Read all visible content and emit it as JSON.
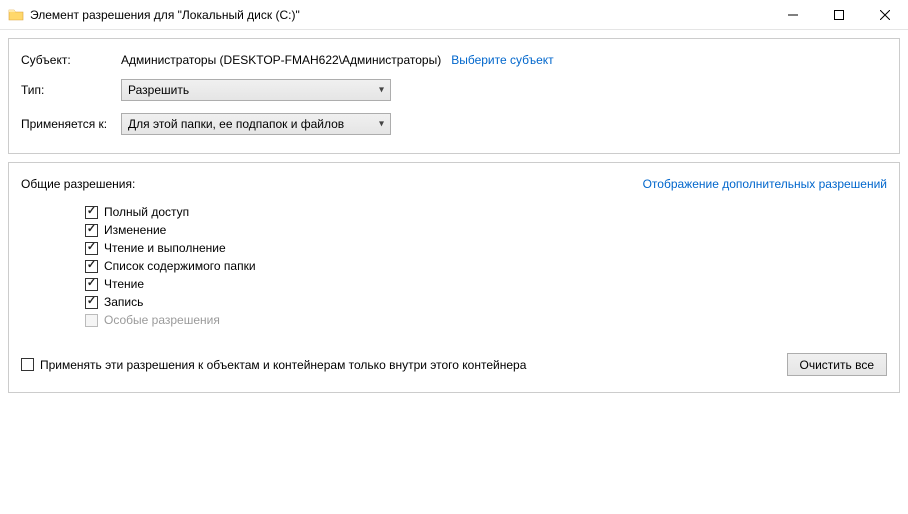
{
  "window": {
    "title": "Элемент разрешения для \"Локальный диск (C:)\""
  },
  "top": {
    "subject_label": "Субъект:",
    "subject_value": "Администраторы (DESKTOP-FMAH622\\Администраторы)",
    "select_subject_link": "Выберите субъект",
    "type_label": "Тип:",
    "type_value": "Разрешить",
    "applies_label": "Применяется к:",
    "applies_value": "Для этой папки, ее подпапок и файлов"
  },
  "perm": {
    "header": "Общие разрешения:",
    "advanced_link": "Отображение дополнительных разрешений",
    "items": [
      {
        "label": "Полный доступ",
        "checked": true,
        "disabled": false
      },
      {
        "label": "Изменение",
        "checked": true,
        "disabled": false
      },
      {
        "label": "Чтение и выполнение",
        "checked": true,
        "disabled": false
      },
      {
        "label": "Список содержимого папки",
        "checked": true,
        "disabled": false
      },
      {
        "label": "Чтение",
        "checked": true,
        "disabled": false
      },
      {
        "label": "Запись",
        "checked": true,
        "disabled": false
      },
      {
        "label": "Особые разрешения",
        "checked": false,
        "disabled": true
      }
    ]
  },
  "bottom": {
    "inherit_label": "Применять эти разрешения к объектам и контейнерам только внутри этого контейнера",
    "inherit_checked": false,
    "clear_all": "Очистить все"
  }
}
